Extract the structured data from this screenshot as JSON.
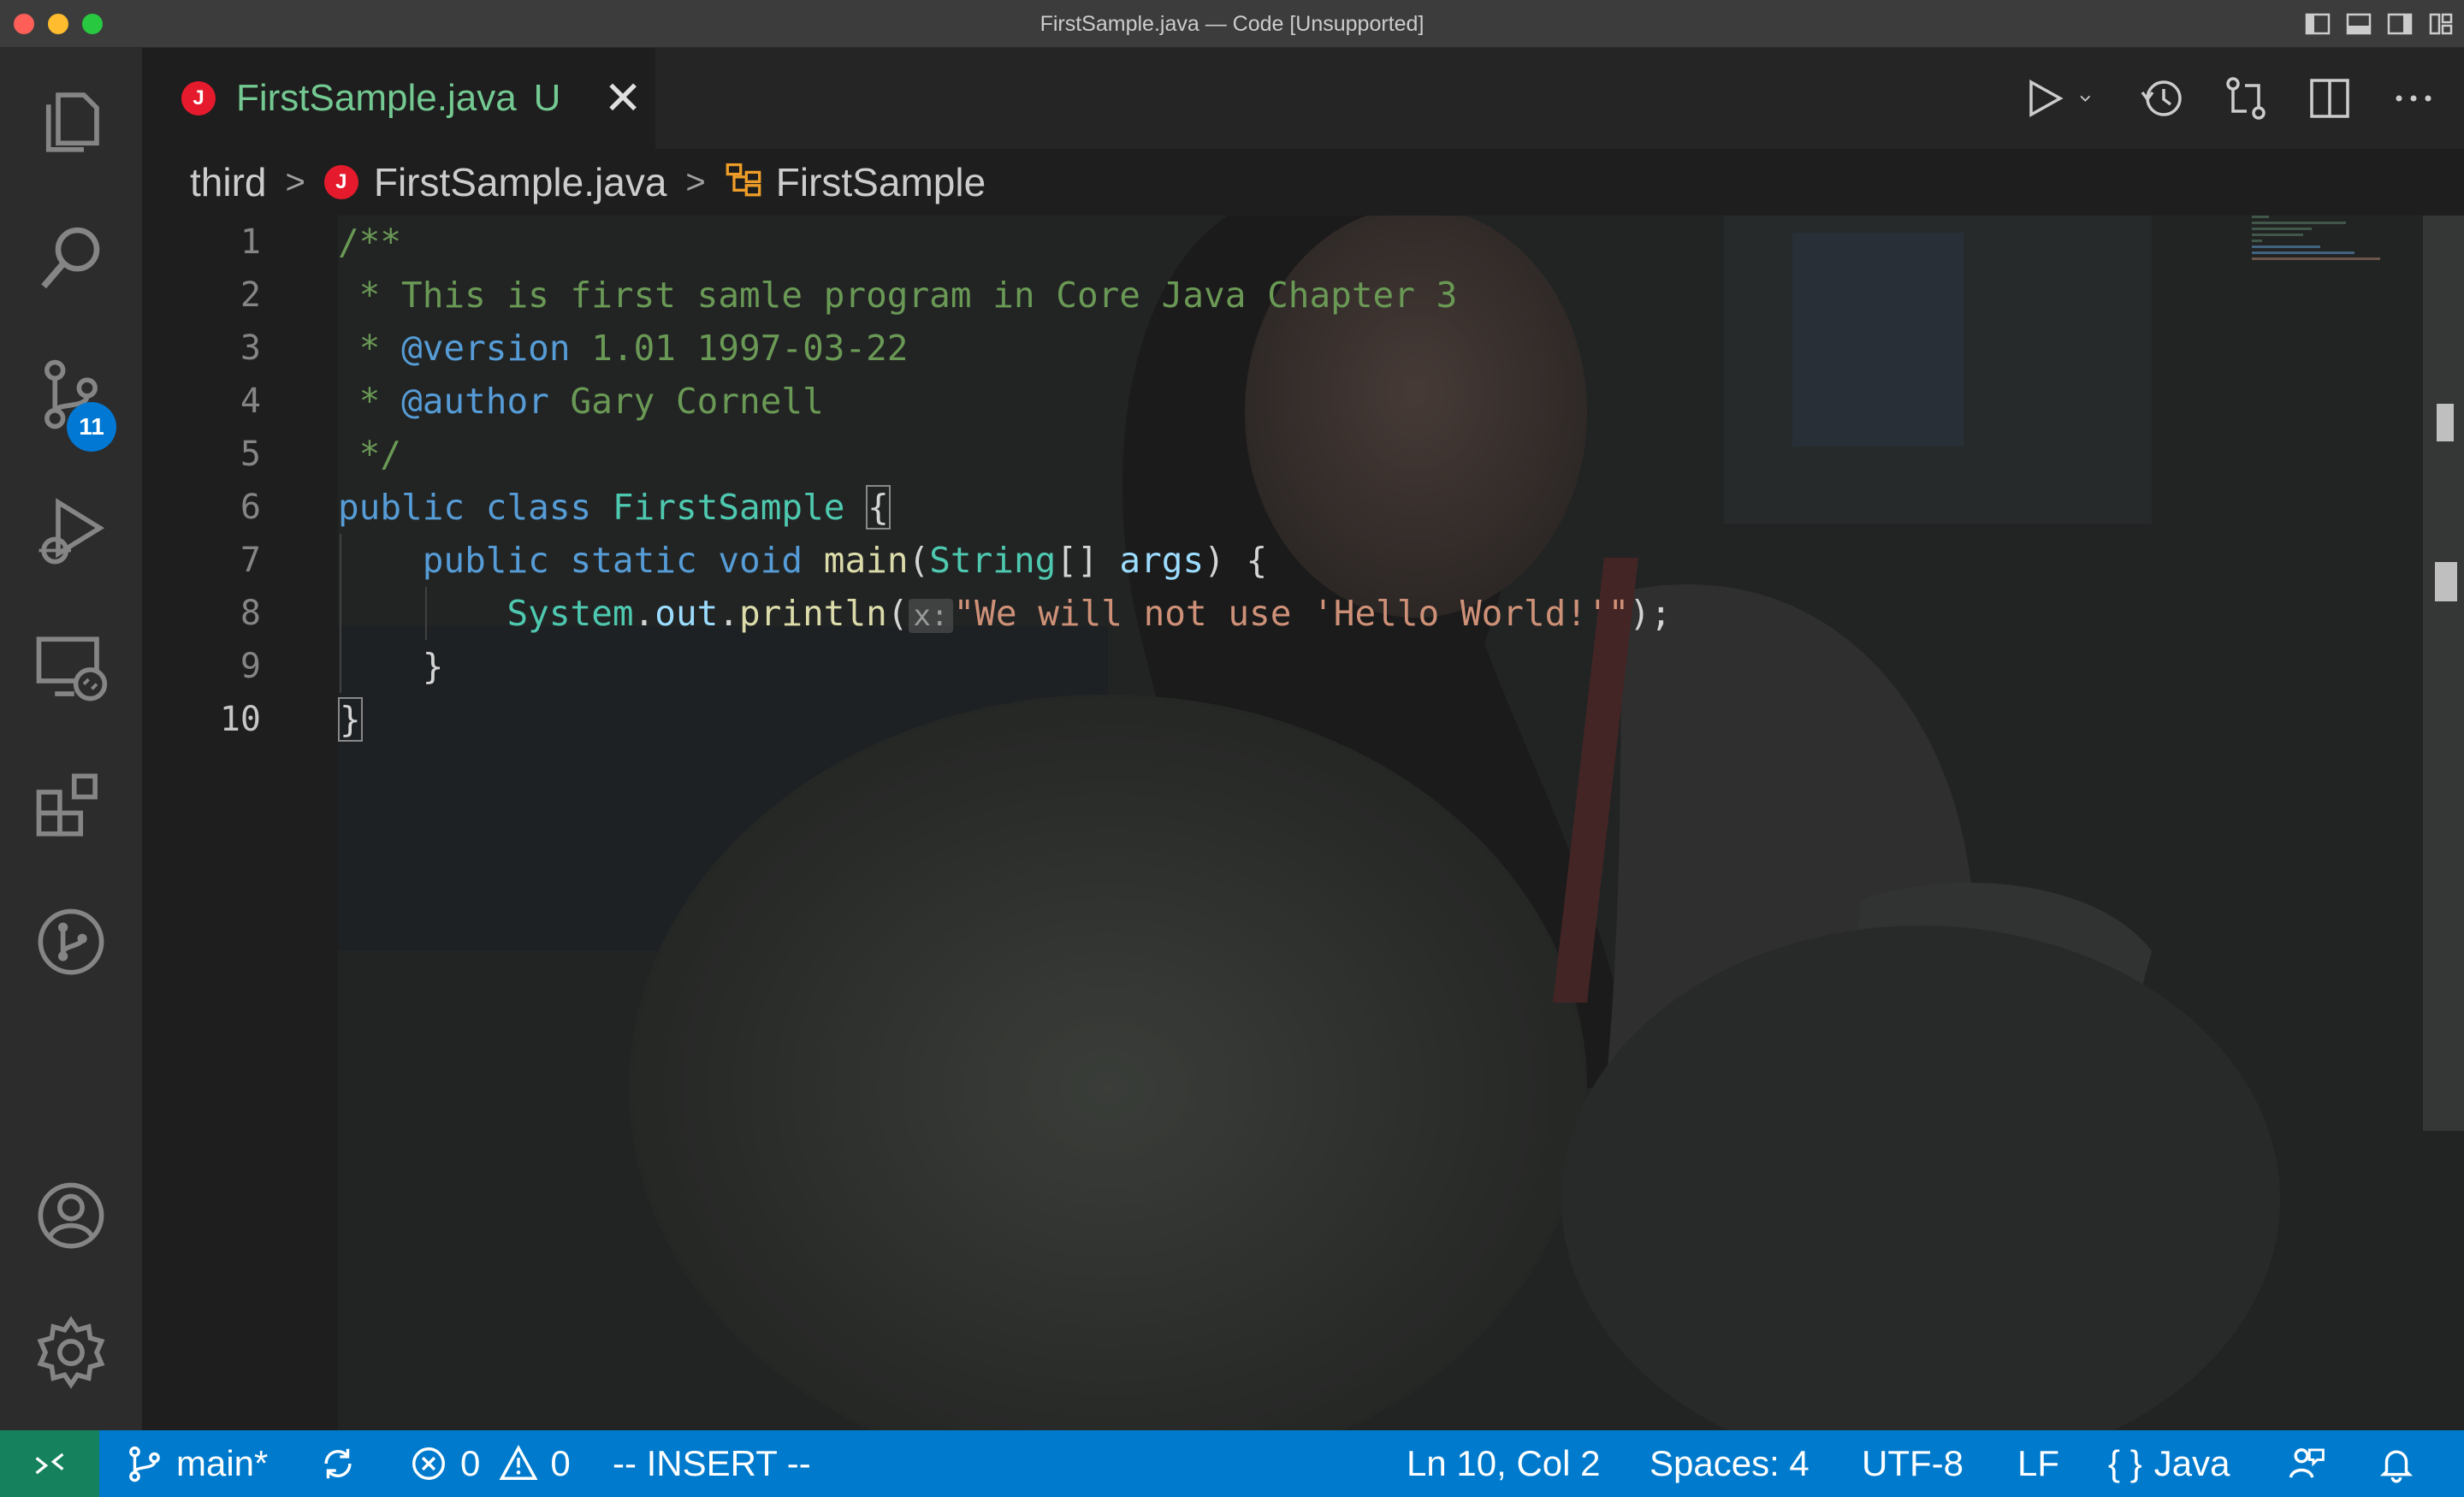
{
  "window": {
    "title": "FirstSample.java — Code [Unsupported]"
  },
  "activity_bar": {
    "items": [
      {
        "name": "explorer-icon"
      },
      {
        "name": "search-icon"
      },
      {
        "name": "source-control-icon",
        "badge": "11"
      },
      {
        "name": "run-debug-icon"
      },
      {
        "name": "remote-explorer-icon"
      },
      {
        "name": "extensions-icon"
      },
      {
        "name": "git-graph-icon"
      },
      {
        "name": "account-icon"
      },
      {
        "name": "settings-gear-icon"
      }
    ]
  },
  "tab": {
    "icon_letter": "J",
    "label": "FirstSample.java",
    "status": "U",
    "close": "✕"
  },
  "breadcrumb": {
    "folder": "third",
    "file": "FirstSample.java",
    "symbol": "FirstSample",
    "separator": ">"
  },
  "editor": {
    "line_numbers": [
      "1",
      "2",
      "3",
      "4",
      "5",
      "6",
      "7",
      "8",
      "9",
      "10"
    ],
    "active_line": "10",
    "inlay_hint": "x:",
    "code": {
      "l1": "/**",
      "l2": " * This is first samle program in Core Java Chapter 3",
      "l3_star": " * ",
      "l3_tag": "@version",
      "l3_rest": " 1.01 1997-03-22",
      "l4_star": " * ",
      "l4_tag": "@author",
      "l4_rest": " Gary Cornell",
      "l5": " */",
      "l6_kw1": "public",
      "l6_kw2": "class",
      "l6_cls": "FirstSample",
      "l6_brace": "{",
      "l7_kw1": "public",
      "l7_kw2": "static",
      "l7_kw3": "void",
      "l7_fn": "main",
      "l7_open": "(",
      "l7_type": "String",
      "l7_arr": "[]",
      "l7_var": "args",
      "l7_close": ") {",
      "l8_cls": "System",
      "l8_dot1": ".",
      "l8_field": "out",
      "l8_dot2": ".",
      "l8_fn": "println",
      "l8_open": "(",
      "l8_str": "\"We will not use 'Hello World!'\"",
      "l8_close": ");",
      "l9": "}",
      "l10": "}"
    }
  },
  "status_bar": {
    "branch": "main*",
    "errors": "0",
    "warnings": "0",
    "mode": "-- INSERT --",
    "position": "Ln 10, Col 2",
    "spaces": "Spaces: 4",
    "encoding": "UTF-8",
    "eol": "LF",
    "language_icon": "{ }",
    "language": "Java"
  },
  "colors": {
    "status_bar": "#007acc",
    "remote_indicator": "#16825d",
    "tab_text_untracked": "#73c991",
    "java_icon": "#e51b2d",
    "comment": "#6a9955",
    "keyword": "#569cd6",
    "class": "#4ec9b0",
    "function": "#dcdcaa",
    "string": "#ce9178"
  }
}
